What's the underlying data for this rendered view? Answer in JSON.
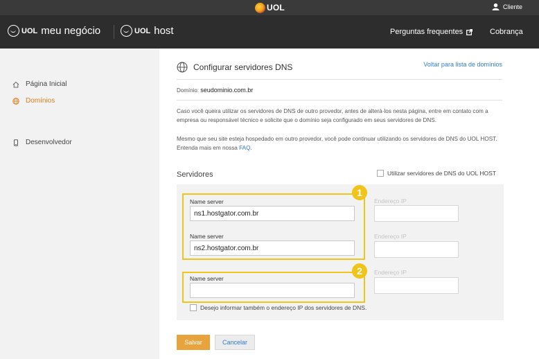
{
  "topbar": {
    "logo_text": "UOL",
    "user_label": "Cliente"
  },
  "header": {
    "brand1": {
      "logo": "UOL",
      "product": "meu negócio"
    },
    "brand2": {
      "logo": "UOL",
      "product": "host"
    },
    "nav": {
      "faq": "Perguntas frequentes",
      "billing": "Cobrança"
    }
  },
  "sidebar": {
    "items": [
      {
        "label": "Página Inicial",
        "icon": "home-icon"
      },
      {
        "label": "Domínios",
        "icon": "globe-icon",
        "active": true
      },
      {
        "label": "Desenvolvedor",
        "icon": "phone-icon"
      }
    ]
  },
  "main": {
    "title": "Configurar servidores DNS",
    "back_link": "Voltar para lista de domínios",
    "domain_label": "Domínio:",
    "domain_value": "seudominio.com.br",
    "para1": "Caso você queira utilizar os servidores de DNS de outro provedor, antes de alterá-los nesta página, entre em contato com a empresa ou responsável técnico e solicite que o domínio seja configurado em seus servidores de DNS.",
    "para2_text": "Mesmo que seu site esteja hospedado em outro provedor, você pode continuar utilizando os servidores de DNS do UOL HOST. Entenda mais em nossa",
    "para2_link": "FAQ",
    "para2_end": ".",
    "servers_title": "Servidores",
    "use_uol_label": "Utilizar servidores de DNS do UOL HOST",
    "servers": [
      {
        "label": "Name server",
        "value": "ns1.hostgator.com.br",
        "ip_label": "Endereço IP",
        "ip_value": ""
      },
      {
        "label": "Name server",
        "value": "ns2.hostgator.com.br",
        "ip_label": "Endereço IP",
        "ip_value": ""
      },
      {
        "label": "Name server",
        "value": "",
        "ip_label": "Endereço IP",
        "ip_value": ""
      }
    ],
    "also_ip_label": "Desejo informar também o endereço IP dos servidores de DNS.",
    "badges": [
      "1",
      "2"
    ],
    "save_label": "Salvar",
    "cancel_label": "Cancelar"
  },
  "colors": {
    "accent": "#e07b1a",
    "link": "#2f7ad0",
    "highlight": "#f0c419",
    "save": "#e8a33d"
  }
}
